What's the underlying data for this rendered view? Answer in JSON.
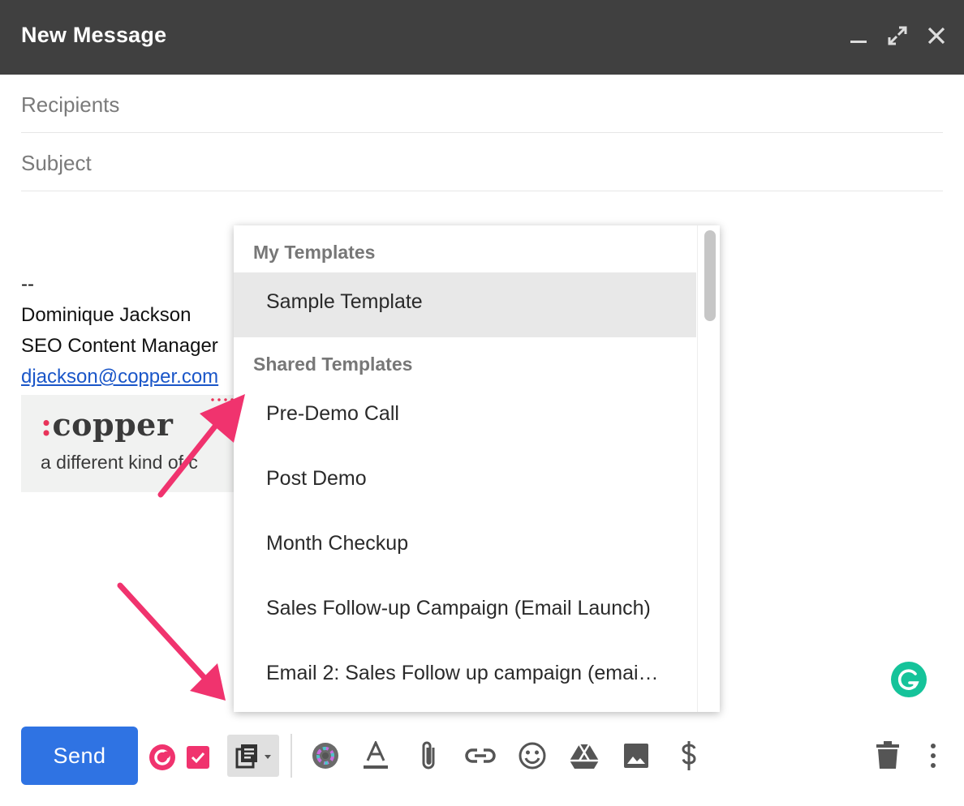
{
  "window": {
    "title": "New Message",
    "controls": [
      "minimize-icon",
      "expand-icon",
      "close-icon"
    ]
  },
  "fields": {
    "recipients_placeholder": "Recipients",
    "subject_placeholder": "Subject"
  },
  "signature": {
    "dashes": "--",
    "name": "Dominique Jackson",
    "role": "SEO Content Manager",
    "email": "djackson@copper.com",
    "logo_name": "copper",
    "logo_colon": ":",
    "logo_tagline": "a different kind of c"
  },
  "templates_menu": {
    "my_templates_header": "My Templates",
    "my_templates": [
      "Sample Template"
    ],
    "shared_templates_header": "Shared Templates",
    "shared_templates": [
      "Pre-Demo Call",
      "Post Demo",
      "Month Checkup",
      "Sales Follow-up Campaign (Email Launch)",
      "Email 2: Sales Follow up campaign (emai…"
    ],
    "selected": "Sample Template"
  },
  "toolbar": {
    "send_label": "Send",
    "icons": [
      "copper-icon",
      "task-check-icon",
      "templates-icon",
      "color-wheel-icon",
      "text-format-icon",
      "attach-icon",
      "link-icon",
      "emoji-icon",
      "drive-icon",
      "image-icon",
      "dollar-icon",
      "trash-icon",
      "more-vert-icon"
    ]
  },
  "colors": {
    "titlebar": "#404040",
    "send_button": "#2f73e3",
    "accent_pink": "#f0336e",
    "copper_red": "#e8345a",
    "grammarly_green": "#15c39a",
    "selected_item": "#e8e8e8"
  }
}
